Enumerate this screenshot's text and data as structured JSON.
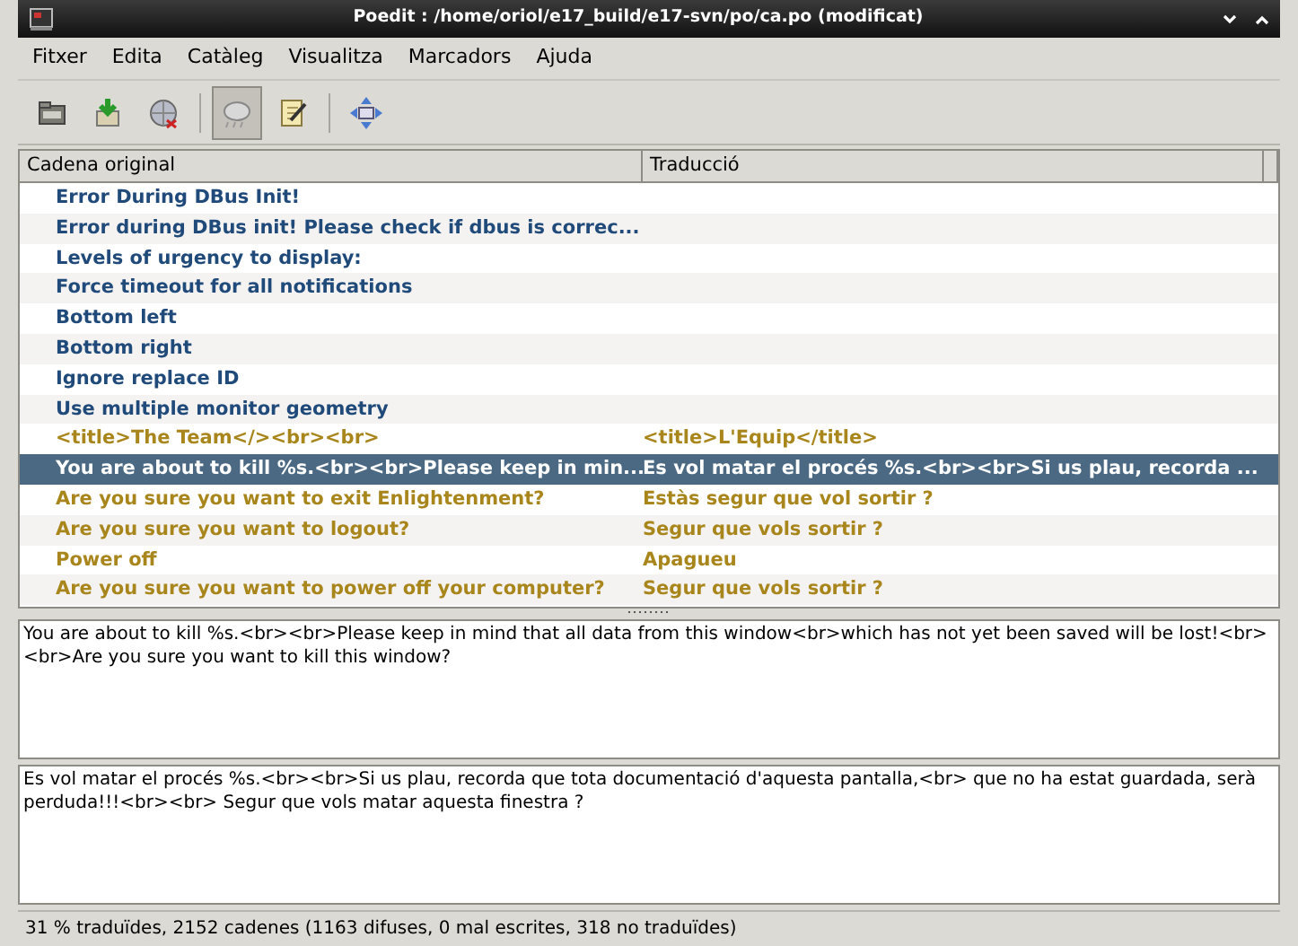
{
  "window": {
    "title": "Poedit : /home/oriol/e17_build/e17-svn/po/ca.po (modificat)"
  },
  "menu": [
    "Fitxer",
    "Edita",
    "Catàleg",
    "Visualitza",
    "Marcadors",
    "Ajuda"
  ],
  "toolbar": [
    {
      "kind": "open",
      "on": false
    },
    {
      "kind": "save",
      "on": false
    },
    {
      "kind": "globe",
      "on": false
    },
    {
      "kind": "cloud",
      "on": true
    },
    {
      "kind": "edit",
      "on": false
    },
    {
      "kind": "move",
      "on": false
    }
  ],
  "table": {
    "columns": [
      "Cadena original",
      "Traducció"
    ],
    "rows": [
      {
        "kind": "untranslated",
        "selected": false,
        "original": "Error During DBus Init!"
      },
      {
        "kind": "untranslated",
        "selected": false,
        "original": "Error during DBus init! Please check if dbus is correc..."
      },
      {
        "kind": "untranslated",
        "selected": false,
        "original": "Levels of urgency to display:"
      },
      {
        "kind": "untranslated",
        "selected": false,
        "original": "Force timeout for all notifications"
      },
      {
        "kind": "untranslated",
        "selected": false,
        "original": "Bottom left"
      },
      {
        "kind": "untranslated",
        "selected": false,
        "original": "Bottom right"
      },
      {
        "kind": "untranslated",
        "selected": false,
        "original": "Ignore replace ID"
      },
      {
        "kind": "untranslated",
        "selected": false,
        "original": "Use multiple monitor geometry"
      },
      {
        "kind": "fuzzy",
        "selected": false,
        "original": "<title>The Team</><br><br>",
        "translation": "<title>L'Equip</title>"
      },
      {
        "kind": "fuzzy",
        "selected": true,
        "original": "You are about to kill %s.<br><br>Please keep in min...",
        "translation": "Es vol matar el procés %s.<br><br>Si us plau, recorda ..."
      },
      {
        "kind": "fuzzy",
        "selected": false,
        "original": "Are you sure you want to exit Enlightenment?",
        "translation": "Estàs segur que vol sortir ?"
      },
      {
        "kind": "fuzzy",
        "selected": false,
        "original": "Are you sure you want to logout?",
        "translation": "Segur que vols sortir ?"
      },
      {
        "kind": "fuzzy",
        "selected": false,
        "original": "Power off",
        "translation": "Apagueu"
      },
      {
        "kind": "fuzzy",
        "selected": false,
        "original": "Are you sure you want to power off your computer?",
        "translation": "Segur que vols sortir ?"
      }
    ]
  },
  "source_text": "You are about to kill %s.<br><br>Please keep in mind that all data from this window<br>which has not yet been saved will be lost!<br><br>Are you sure you want to kill this window?",
  "translation_text": "Es vol matar el procés %s.<br><br>Si us plau, recorda que tota documentació d'aquesta pantalla,<br> que no ha estat guardada, serà perduda!!!<br><br> Segur que vols matar aquesta finestra ?",
  "status_bar": "31 % traduïdes, 2152 cadenes (1163 difuses, 0 mal escrites, 318 no traduïdes)"
}
